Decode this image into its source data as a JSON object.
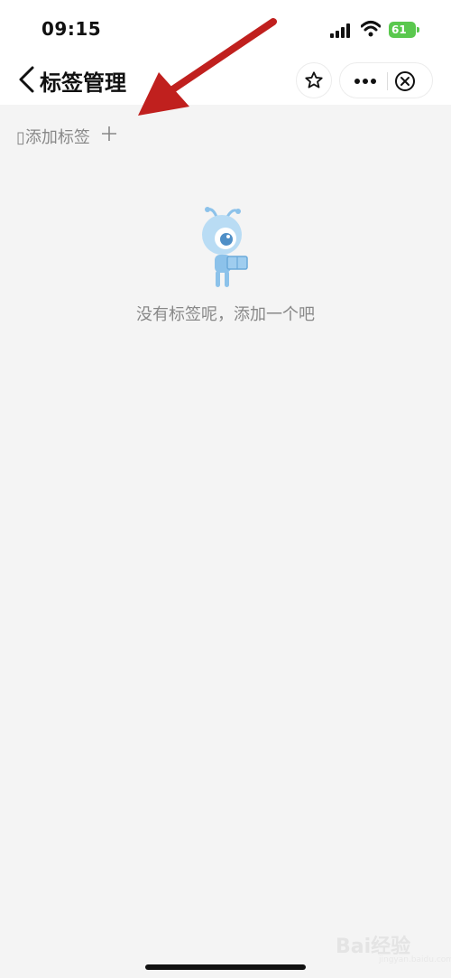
{
  "status_bar": {
    "time": "09:15",
    "battery": "61"
  },
  "header": {
    "title": "标签管理"
  },
  "content": {
    "add_tag_label": "▯添加标签",
    "empty_text": "没有标签呢，添加一个吧"
  },
  "watermark": {
    "brand": "Bai经验",
    "url": "jingyan.baidu.com"
  },
  "colors": {
    "accent_arrow": "#c0201e",
    "mascot_blue": "#8cc2ea",
    "battery_green": "#5ac84e"
  }
}
